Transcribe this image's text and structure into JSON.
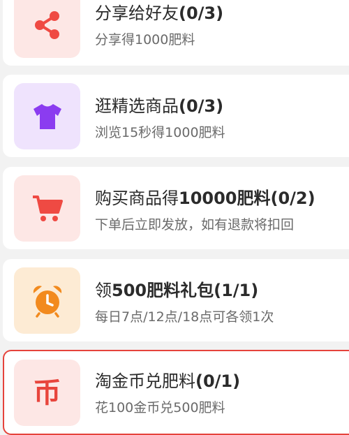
{
  "tasks": [
    {
      "id": "share",
      "title_prefix": "分享给好友",
      "title_highlight": "",
      "title_suffix": "(0/3)",
      "description": "分享得1000肥料",
      "icon": "share-icon",
      "icon_color": "#ef4a43",
      "icon_bg": "#fde7e5"
    },
    {
      "id": "browse",
      "title_prefix": "逛精选商品",
      "title_highlight": "",
      "title_suffix": "(0/3)",
      "description": "浏览15秒得1000肥料",
      "icon": "tshirt-icon",
      "icon_color": "#8b3cf0",
      "icon_bg": "#efe3fd"
    },
    {
      "id": "purchase",
      "title_prefix": "购买商品得",
      "title_highlight": "10000",
      "title_suffix": "肥料(0/2)",
      "description": "下单后立即发放，如有退款将扣回",
      "icon": "shopping-cart-icon",
      "icon_color": "#ef4a43",
      "icon_bg": "#fde7e5"
    },
    {
      "id": "gift",
      "title_prefix": "领",
      "title_highlight": "500",
      "title_suffix": "肥料礼包(1/1)",
      "description": "每日7点/12点/18点可各领1次",
      "icon": "alarm-clock-icon",
      "icon_color": "#f28a1e",
      "icon_bg": "#fdebd4"
    },
    {
      "id": "exchange",
      "title_prefix": "淘金币兑肥料",
      "title_highlight": "",
      "title_suffix": "(0/1)",
      "description": "花100金币兑500肥料",
      "icon": "gold-coin-icon",
      "icon_glyph": "币",
      "icon_color": "#e8453c",
      "icon_bg": "#fde7e5"
    }
  ]
}
